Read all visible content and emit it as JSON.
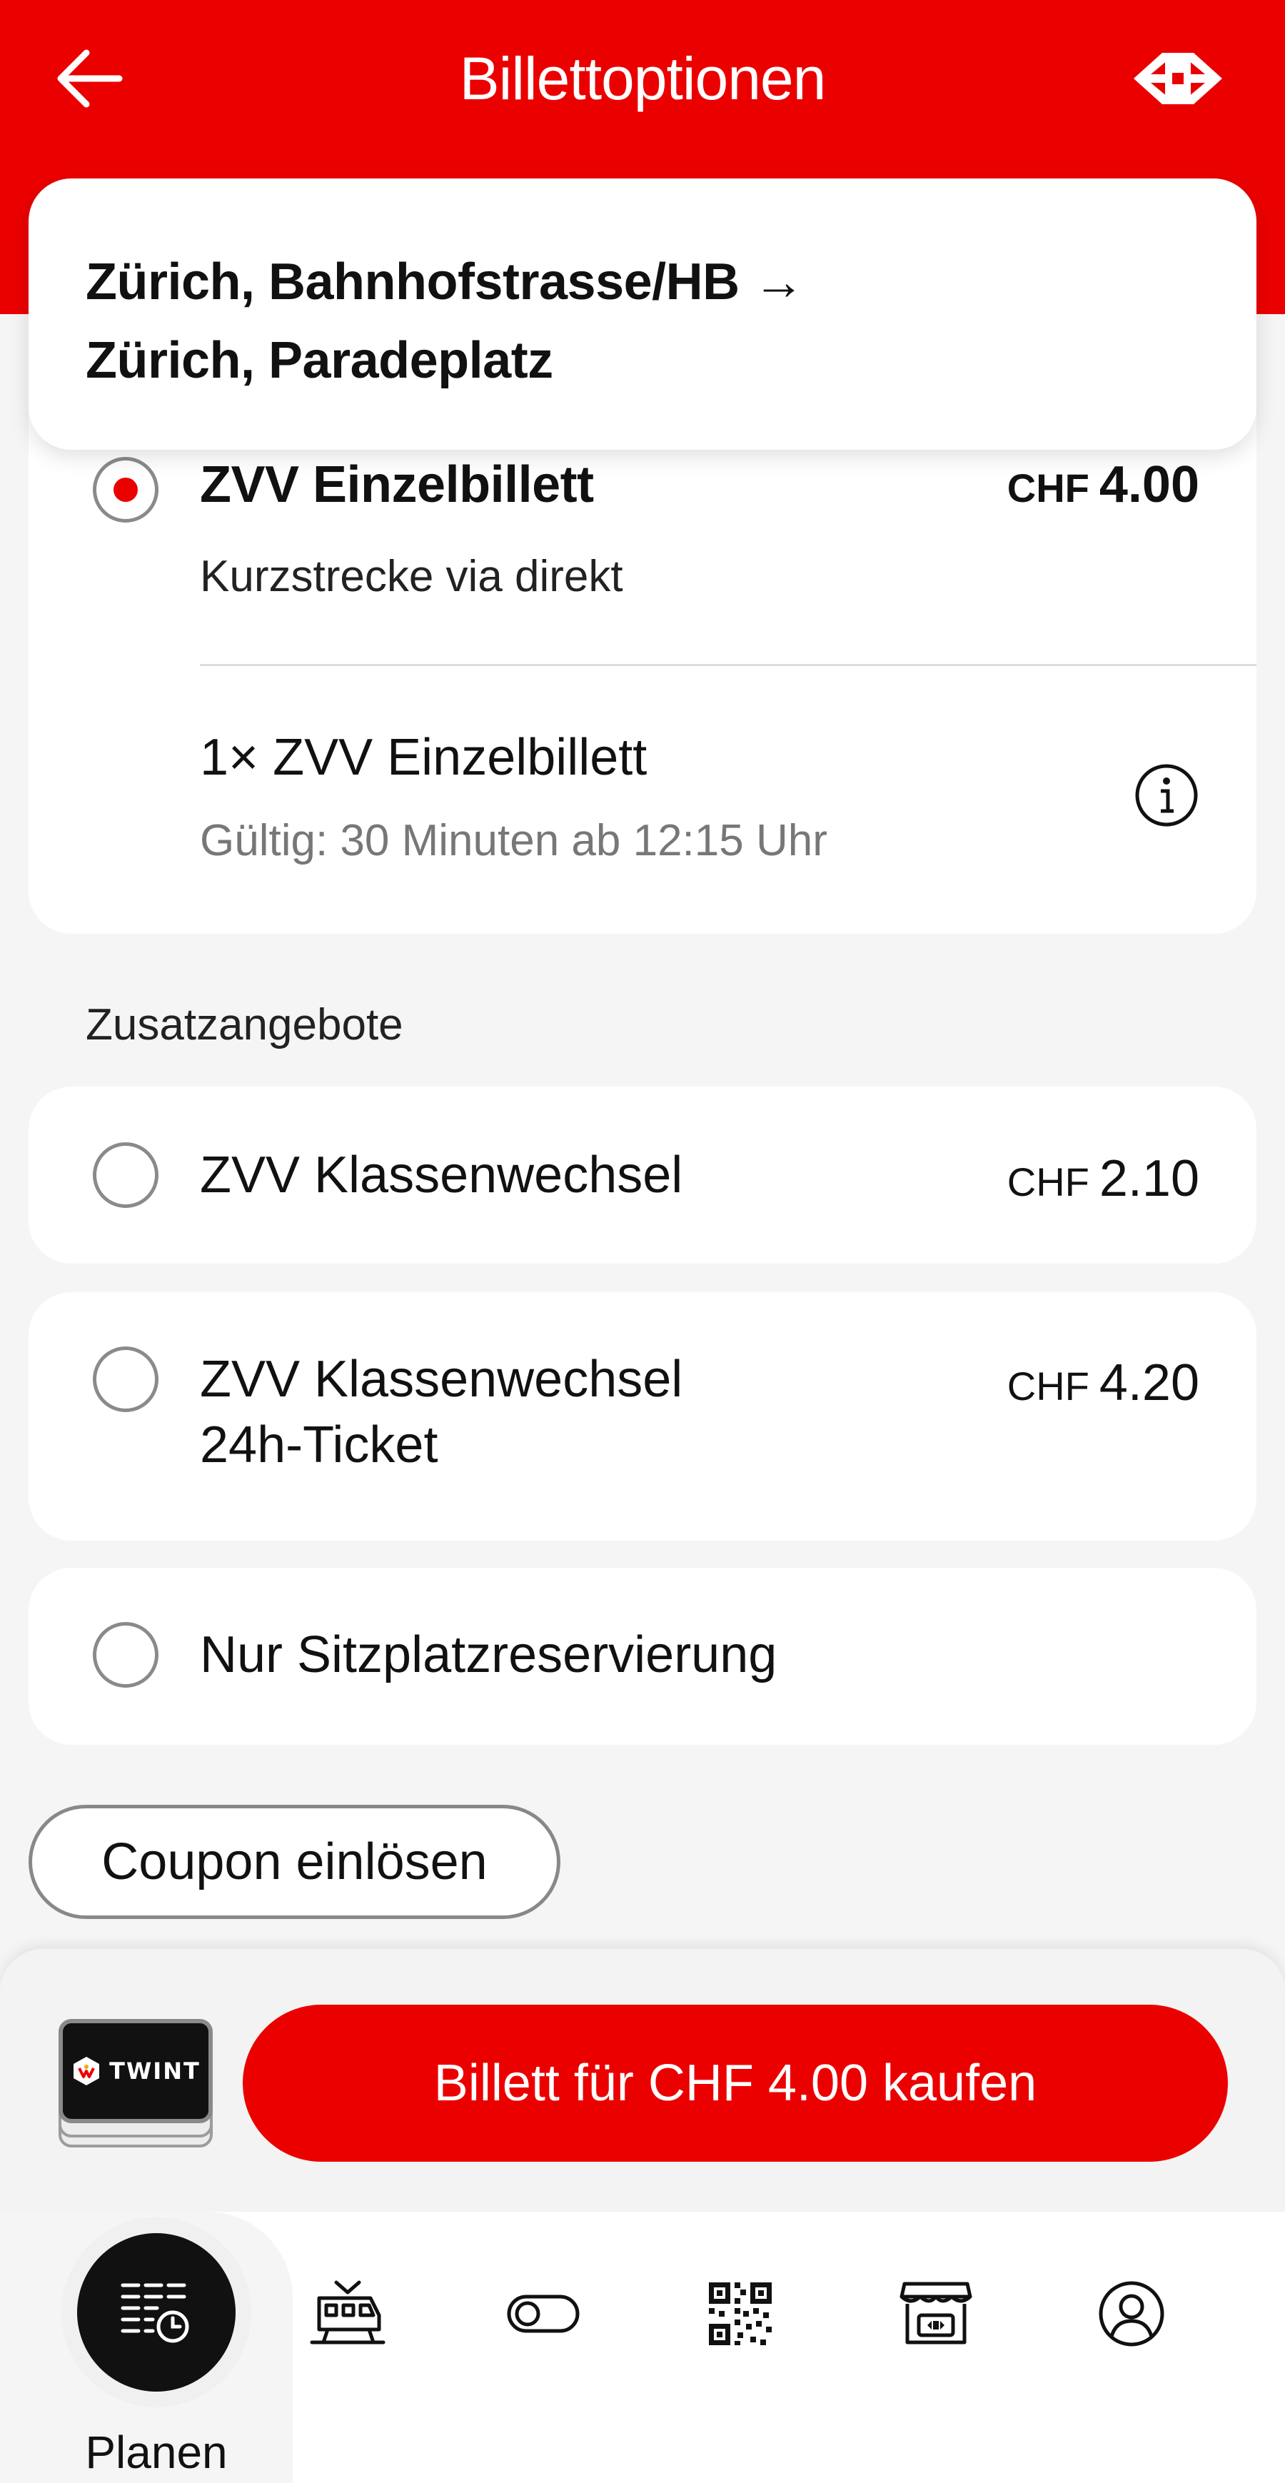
{
  "header": {
    "title": "Billettoptionen"
  },
  "route": {
    "from": "Zürich, Bahnhofstrasse/HB →",
    "to": "Zürich, Paradeplatz"
  },
  "ticket": {
    "name": "ZVV Einzelbillett",
    "currency": "CHF",
    "price": "4.00",
    "subtitle": "Kurzstrecke via direkt",
    "item": "1× ZVV Einzelbillett",
    "validity": "Gültig: 30 Minuten ab 12:15 Uhr",
    "selected": true
  },
  "extras": {
    "label": "Zusatzangebote",
    "options": [
      {
        "label": "ZVV Klassenwechsel",
        "currency": "CHF",
        "price": "2.10"
      },
      {
        "label": "ZVV Klassenwechsel",
        "label2": "24h-Ticket",
        "currency": "CHF",
        "price": "4.20"
      },
      {
        "label": "Nur Sitzplatzreservierung"
      }
    ]
  },
  "coupon": {
    "label": "Coupon einlösen"
  },
  "payment": {
    "method": "TWINT",
    "buy_label": "Billett für CHF 4.00 kaufen"
  },
  "tabbar": {
    "active_label": "Planen",
    "icons": [
      "plan-icon",
      "train-icon",
      "toggle-icon",
      "qr-code-icon",
      "shop-icon",
      "profile-icon"
    ]
  },
  "colors": {
    "brand_red": "#eb0000",
    "background": "#f5f5f5",
    "card": "#ffffff"
  }
}
